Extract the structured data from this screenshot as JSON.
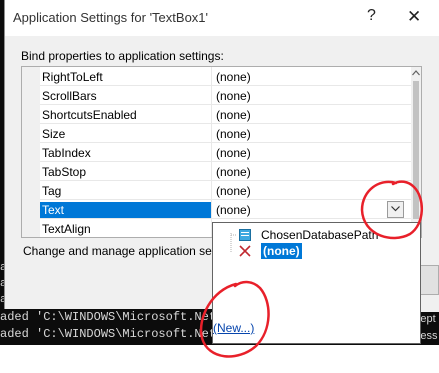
{
  "window": {
    "title": "Application Settings for 'TextBox1'",
    "help_glyph": "?",
    "close_glyph": "✕"
  },
  "bind_label": "Bind properties to application settings:",
  "grid": {
    "rows": [
      {
        "name": "RightToLeft",
        "value": "(none)"
      },
      {
        "name": "ScrollBars",
        "value": "(none)"
      },
      {
        "name": "ShortcutsEnabled",
        "value": "(none)"
      },
      {
        "name": "Size",
        "value": "(none)"
      },
      {
        "name": "TabIndex",
        "value": "(none)"
      },
      {
        "name": "TabStop",
        "value": "(none)"
      },
      {
        "name": "Tag",
        "value": "(none)"
      },
      {
        "name": "Text",
        "value": "(none)",
        "selected": true
      },
      {
        "name": "TextAlign",
        "value": ""
      }
    ]
  },
  "manage_label": "Change and manage application sett",
  "dropdown": {
    "items": [
      {
        "label": "ChosenDatabasePath",
        "icon": "settings-file-icon"
      },
      {
        "label": "(none)",
        "icon": "delete-x-icon",
        "selected": true
      }
    ],
    "new_link": "(New...)"
  },
  "console": {
    "lines": [
      "aded 'C:\\WINDOWS\\Microsoft.Net",
      "aded 'C:\\WINDOWS\\Microsoft.Net"
    ],
    "right_lines": [
      "Accept",
      "Access"
    ],
    "fragments": [
      "a",
      "a",
      "a"
    ]
  },
  "colors": {
    "selection": "#0078d7",
    "annotation": "#e8202a",
    "console_bg": "#0c0c0c"
  }
}
